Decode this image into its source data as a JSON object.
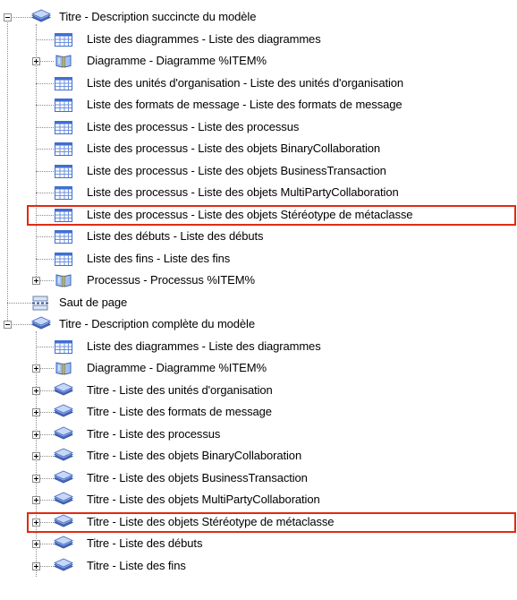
{
  "tree": {
    "items": [
      {
        "label": "Titre - Description succincte du modèle",
        "icon": "title-stack-icon",
        "level": 0,
        "expander": "minus"
      },
      {
        "label": "Liste des diagrammes - Liste des diagrammes",
        "icon": "table-list-icon",
        "level": 1,
        "expander": "none"
      },
      {
        "label": "Diagramme - Diagramme %ITEM%",
        "icon": "book-icon",
        "level": 1,
        "expander": "plus"
      },
      {
        "label": "Liste des unités d'organisation - Liste des unités d'organisation",
        "icon": "table-list-icon",
        "level": 1,
        "expander": "none"
      },
      {
        "label": "Liste des formats de message - Liste des formats de message",
        "icon": "table-list-icon",
        "level": 1,
        "expander": "none"
      },
      {
        "label": "Liste des processus - Liste des processus",
        "icon": "table-list-icon",
        "level": 1,
        "expander": "none"
      },
      {
        "label": "Liste des processus - Liste des objets BinaryCollaboration",
        "icon": "table-list-icon",
        "level": 1,
        "expander": "none"
      },
      {
        "label": "Liste des processus - Liste des objets BusinessTransaction",
        "icon": "table-list-icon",
        "level": 1,
        "expander": "none"
      },
      {
        "label": "Liste des processus - Liste des objets MultiPartyCollaboration",
        "icon": "table-list-icon",
        "level": 1,
        "expander": "none"
      },
      {
        "label": "Liste des processus - Liste des objets Stéréotype de métaclasse",
        "icon": "table-list-icon",
        "level": 1,
        "expander": "none",
        "highlighted": true
      },
      {
        "label": "Liste des débuts - Liste des débuts",
        "icon": "table-list-icon",
        "level": 1,
        "expander": "none"
      },
      {
        "label": "Liste des fins - Liste des fins",
        "icon": "table-list-icon",
        "level": 1,
        "expander": "none"
      },
      {
        "label": "Processus - Processus %ITEM%",
        "icon": "book-icon",
        "level": 1,
        "expander": "plus"
      },
      {
        "label": "Saut de page",
        "icon": "page-break-icon",
        "level": 0,
        "expander": "none"
      },
      {
        "label": "Titre - Description complète du modèle",
        "icon": "title-stack-icon",
        "level": 0,
        "expander": "minus"
      },
      {
        "label": "Liste des diagrammes - Liste des diagrammes",
        "icon": "table-list-icon",
        "level": 1,
        "expander": "none"
      },
      {
        "label": "Diagramme - Diagramme %ITEM%",
        "icon": "book-icon",
        "level": 1,
        "expander": "plus"
      },
      {
        "label": "Titre - Liste des unités d'organisation",
        "icon": "title-stack-icon",
        "level": 1,
        "expander": "plus"
      },
      {
        "label": "Titre - Liste des formats de message",
        "icon": "title-stack-icon",
        "level": 1,
        "expander": "plus"
      },
      {
        "label": "Titre - Liste des processus",
        "icon": "title-stack-icon",
        "level": 1,
        "expander": "plus"
      },
      {
        "label": "Titre - Liste des objets BinaryCollaboration",
        "icon": "title-stack-icon",
        "level": 1,
        "expander": "plus"
      },
      {
        "label": "Titre - Liste des objets BusinessTransaction",
        "icon": "title-stack-icon",
        "level": 1,
        "expander": "plus"
      },
      {
        "label": "Titre - Liste des objets MultiPartyCollaboration",
        "icon": "title-stack-icon",
        "level": 1,
        "expander": "plus"
      },
      {
        "label": "Titre - Liste des objets Stéréotype de métaclasse",
        "icon": "title-stack-icon",
        "level": 1,
        "expander": "plus",
        "highlighted": true
      },
      {
        "label": "Titre - Liste des débuts",
        "icon": "title-stack-icon",
        "level": 1,
        "expander": "plus"
      },
      {
        "label": "Titre - Liste des fins",
        "icon": "title-stack-icon",
        "level": 1,
        "expander": "plus"
      }
    ]
  },
  "colors": {
    "highlight_border": "#e02b12",
    "connector": "#8c8c8c",
    "table_icon_blue": "#3f6fd0",
    "title_icon_blue": "#5b7fd6"
  }
}
